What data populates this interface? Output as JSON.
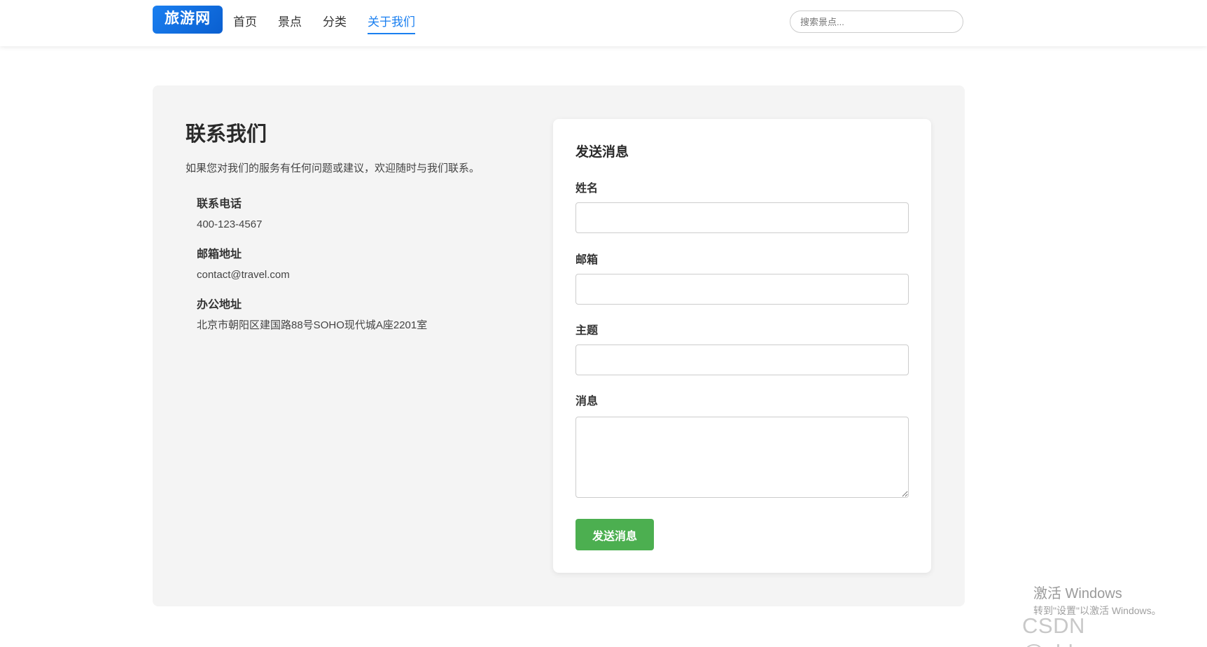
{
  "header": {
    "logo": "旅游网",
    "nav": [
      {
        "label": "首页"
      },
      {
        "label": "景点"
      },
      {
        "label": "分类"
      },
      {
        "label": "关于我们",
        "active": true
      }
    ],
    "search_placeholder": "搜索景点..."
  },
  "contact": {
    "title": "联系我们",
    "description": "如果您对我们的服务有任何问题或建议，欢迎随时与我们联系。",
    "items": [
      {
        "label": "联系电话",
        "value": "400-123-4567"
      },
      {
        "label": "邮箱地址",
        "value": "contact@travel.com"
      },
      {
        "label": "办公地址",
        "value": "北京市朝阳区建国路88号SOHO现代城A座2201室"
      }
    ]
  },
  "form": {
    "title": "发送消息",
    "fields": {
      "name": {
        "label": "姓名",
        "value": ""
      },
      "email": {
        "label": "邮箱",
        "value": ""
      },
      "subject": {
        "label": "主题",
        "value": ""
      },
      "message": {
        "label": "消息",
        "value": ""
      }
    },
    "submit_label": "发送消息"
  },
  "watermarks": {
    "activate_title": "激活 Windows",
    "activate_sub": "转到\"设置\"以激活 Windows。",
    "csdn": "CSDN @ybb_ymm"
  },
  "colors": {
    "brand": "#1a7ff0",
    "submit": "#4caf50",
    "panel_bg": "#f4f4f4"
  }
}
